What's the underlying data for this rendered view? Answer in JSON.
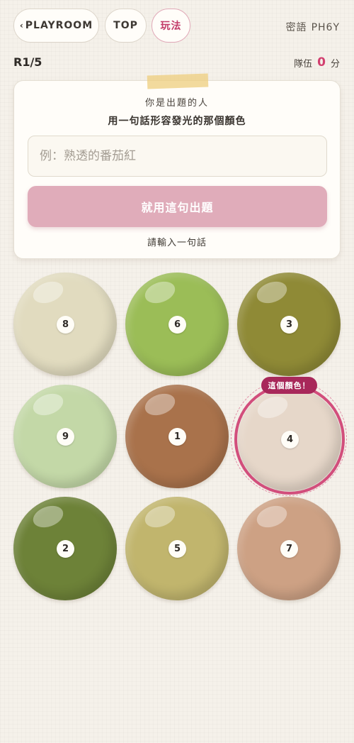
{
  "nav": {
    "back_label": "PLAYROOM",
    "top_label": "TOP",
    "rules_label": "玩法",
    "room_code_label": "密語",
    "room_code": "PH6Y"
  },
  "status": {
    "round": "R1/5",
    "team_label": "隊伍",
    "team_score": "0",
    "score_unit": "分"
  },
  "card": {
    "role": "你是出題的人",
    "prompt": "用一句話形容發光的那個顏色",
    "input_placeholder": "例：熟透的番茄紅",
    "input_value": "",
    "submit_label": "就用這句出題",
    "hint": "請輸入一句話"
  },
  "colors": {
    "selected_number": "4",
    "selected_tag": "這個顏色！",
    "swatches": [
      {
        "number": "8",
        "color": "#e1dbbf"
      },
      {
        "number": "6",
        "color": "#9bbd57"
      },
      {
        "number": "3",
        "color": "#8f8a36"
      },
      {
        "number": "9",
        "color": "#c3d8a7"
      },
      {
        "number": "1",
        "color": "#a9724b"
      },
      {
        "number": "4",
        "color": "#e6d7c9"
      },
      {
        "number": "2",
        "color": "#6d8238"
      },
      {
        "number": "5",
        "color": "#c1b56d"
      },
      {
        "number": "7",
        "color": "#cda184"
      }
    ]
  },
  "theme": {
    "accent": "#d23f6f",
    "tag": "#a8285a",
    "submit": "#e0acba"
  }
}
